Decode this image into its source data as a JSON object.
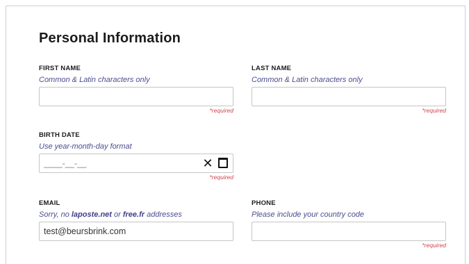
{
  "form": {
    "title": "Personal Information",
    "first_name": {
      "label": "FIRST NAME",
      "hint": "Common & Latin characters only",
      "value": "",
      "required": "*required"
    },
    "last_name": {
      "label": "LAST NAME",
      "hint": "Common & Latin characters only",
      "value": "",
      "required": "*required"
    },
    "birth_date": {
      "label": "BIRTH DATE",
      "hint": "Use year-month-day format",
      "placeholder": "____-__-__",
      "value": "",
      "required": "*required",
      "clear_icon": "close-icon",
      "calendar_icon": "calendar-icon"
    },
    "email": {
      "label": "EMAIL",
      "hint_prefix": "Sorry, no ",
      "hint_domain1": "laposte.net",
      "hint_mid": " or ",
      "hint_domain2": "free.fr",
      "hint_suffix": " addresses",
      "value": "test@beursbrink.com"
    },
    "phone": {
      "label": "PHONE",
      "hint": "Please include your country code",
      "value": "",
      "required": "*required"
    }
  },
  "colors": {
    "hint": "#4b4d8f",
    "required": "#d2434f",
    "border": "#c5c5c5"
  }
}
